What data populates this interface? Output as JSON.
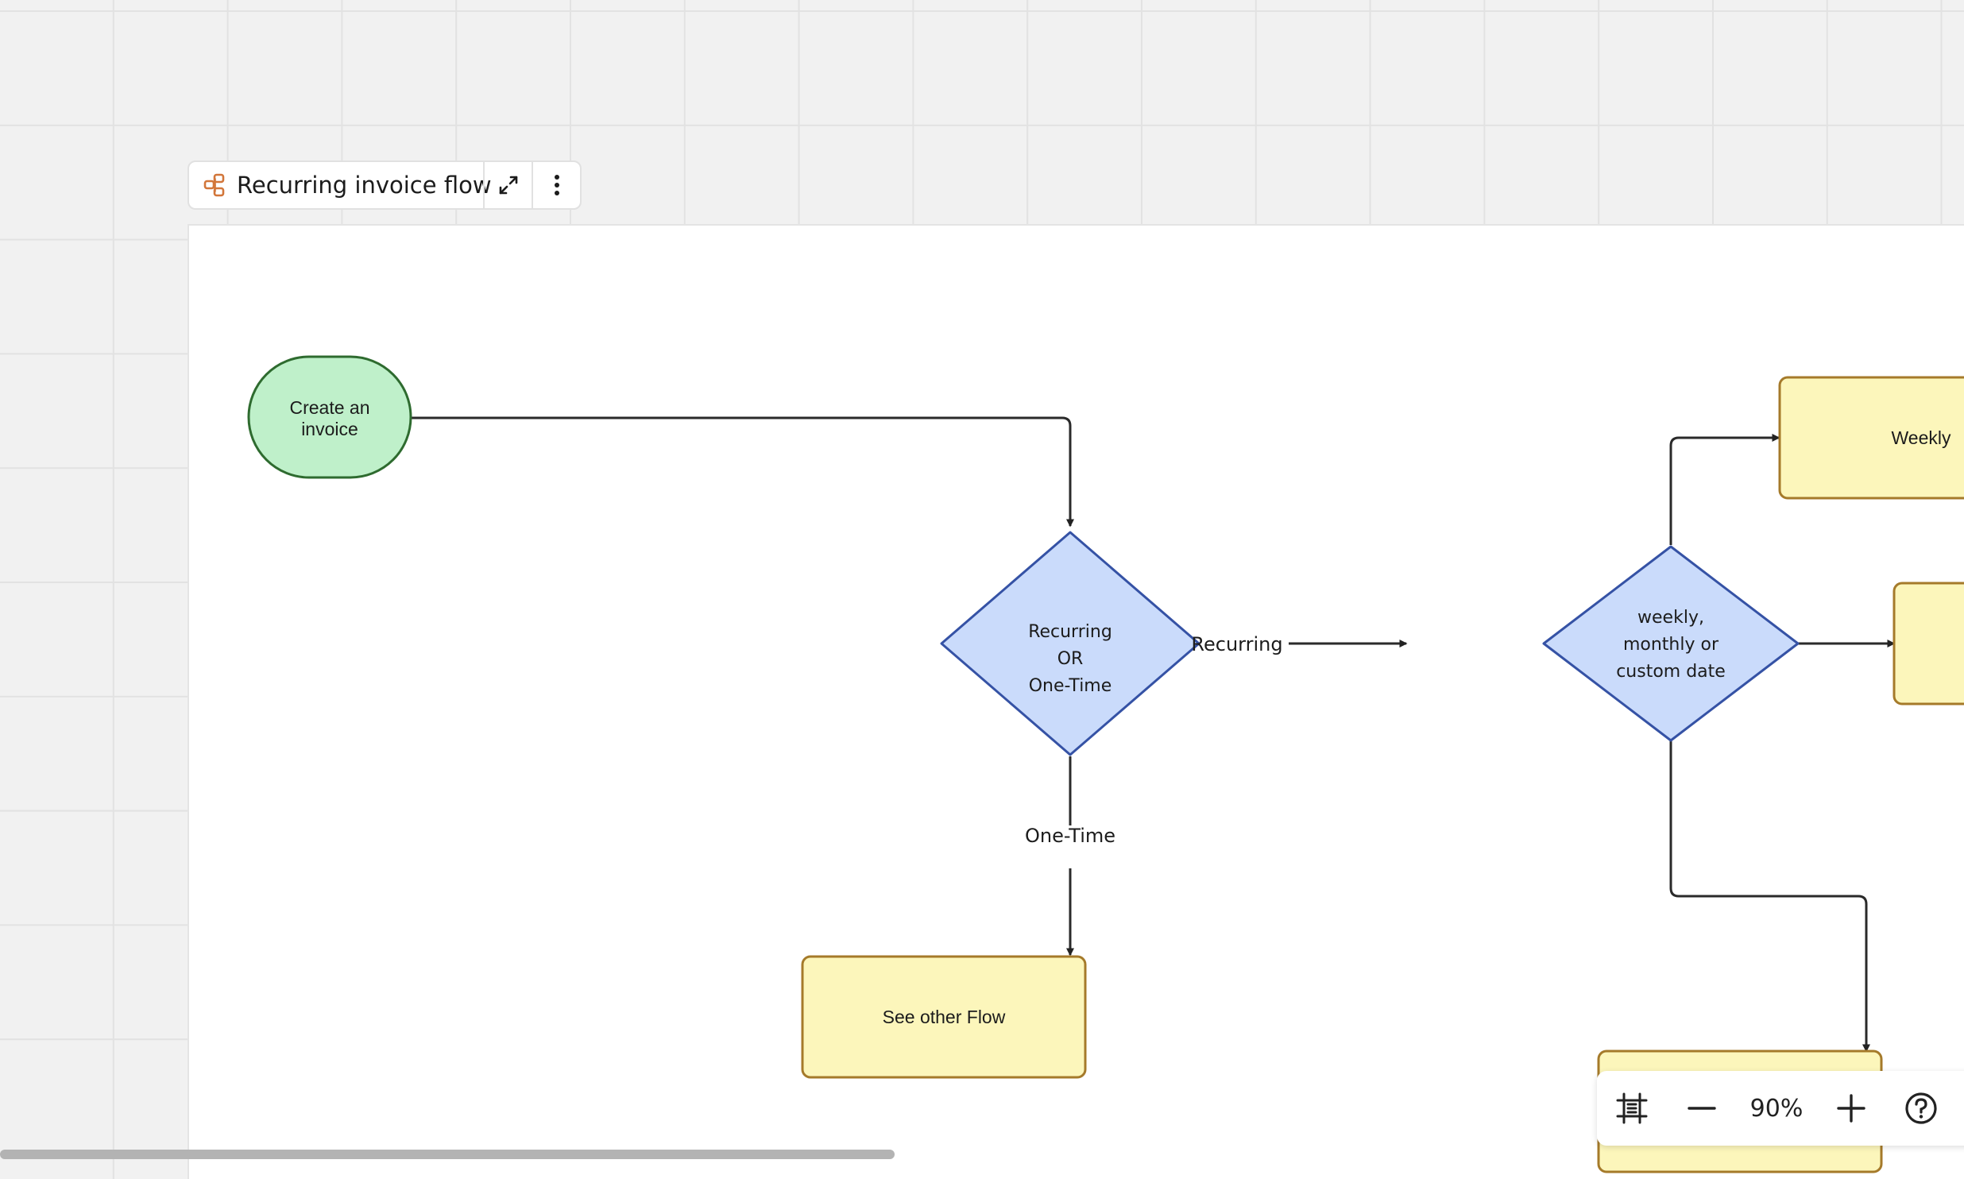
{
  "frame": {
    "title": "Recurring invoice flow",
    "icon": "flow-diagram-icon",
    "expand_icon": "expand-icon",
    "menu_icon": "more-vertical-icon"
  },
  "flow": {
    "nodes": {
      "start": {
        "lines": [
          "Create an",
          "invoice"
        ],
        "shape": "terminal",
        "fill": "#bff0ca",
        "stroke": "#2e6b2f"
      },
      "decision1": {
        "lines": [
          "Recurring",
          "OR",
          "One-Time"
        ],
        "shape": "decision",
        "fill": "#cadbfb",
        "stroke": "#3552a5"
      },
      "decision2": {
        "lines": [
          "weekly,",
          "monthly or",
          "custom date"
        ],
        "shape": "decision",
        "fill": "#cadbfb",
        "stroke": "#3552a5"
      },
      "other_flow": {
        "lines": [
          "See other Flow"
        ],
        "shape": "process",
        "fill": "#fcf6bb",
        "stroke": "#a57a2a"
      },
      "weekly": {
        "lines": [
          "Weekly"
        ],
        "shape": "process",
        "fill": "#fcf6bb",
        "stroke": "#a57a2a"
      },
      "monthly": {
        "lines": [],
        "shape": "process",
        "fill": "#fcf6bb",
        "stroke": "#a57a2a"
      },
      "custom": {
        "lines": [],
        "shape": "process",
        "fill": "#fcf6bb",
        "stroke": "#a57a2a"
      }
    },
    "edge_labels": {
      "recurring": "Recurring",
      "one_time": "One-Time"
    }
  },
  "toolbar": {
    "fit_icon": "fit-to-screen-icon",
    "zoom_out_icon": "zoom-out-icon",
    "zoom_level": "90%",
    "zoom_in_icon": "zoom-in-icon",
    "help_icon": "help-icon"
  }
}
